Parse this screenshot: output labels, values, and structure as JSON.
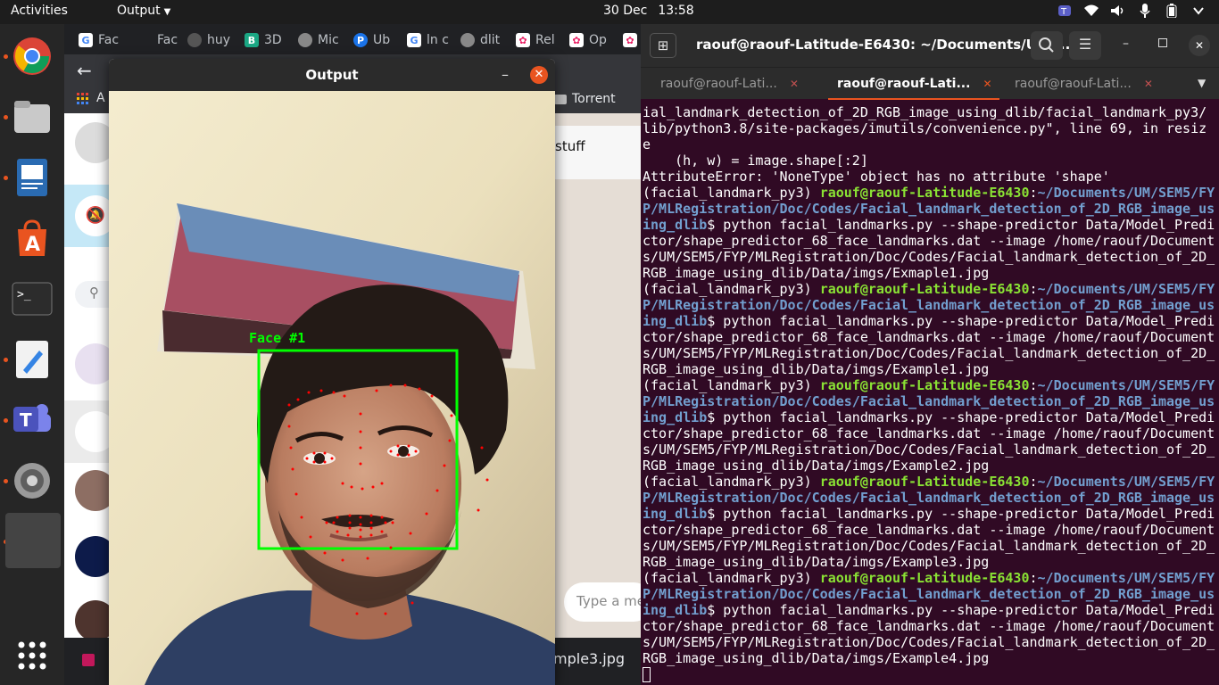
{
  "topbar": {
    "activities": "Activities",
    "app_menu": "Output",
    "date": "30 Dec",
    "time": "13:58"
  },
  "browser": {
    "tabs": [
      "Fac",
      "Fac",
      "huy",
      "3D",
      "Mic",
      "Ub",
      "ln c",
      "dlit",
      "Rel",
      "Op"
    ],
    "bookmarks": {
      "first": "A",
      "folder": "Torrent"
    },
    "chat_header": "stuff",
    "message_placeholder": "Type a message",
    "download_item": "mple3.jpg"
  },
  "output": {
    "title": "Output",
    "face_label": "Face #1",
    "colors": {
      "box": "#00ff00",
      "landmark": "#ff0000"
    }
  },
  "terminal": {
    "window_title": "raouf@raouf-Latitude-E6430: ~/Documents/UM/...",
    "tabs": [
      "raouf@raouf-Lati...",
      "raouf@raouf-Lati...",
      "raouf@raouf-Lati..."
    ],
    "prompt_env": "(facial_landmark_py3) ",
    "prompt_user": "raouf@raouf-Latitude-E6430",
    "prompt_sep": ":",
    "cwd": "~/Documents/UM/SEM5/FYP/MLRegistration/Doc/Codes/Facial_landmark_detection_of_2D_RGB_image_using_dlib",
    "cmd_prefix": "$ python facial_landmarks.py --shape-predictor Data/Model_Predictor/shape_predictor_68_face_landmarks.dat --image /home/raouf/Documents/UM/SEM5/FYP/MLRegistration/Doc/Codes/Facial_landmark_detection_of_2D_RGB_image_using_dlib/Data/imgs/",
    "pre_lines": [
      "ial_landmark_detection_of_2D_RGB_image_using_dlib/facial_landmark_py3/",
      "lib/python3.8/site-packages/imutils/convenience.py\", line 69, in resiz",
      "e",
      "    (h, w) = image.shape[:2]",
      "AttributeError: 'NoneType' object has no attribute 'shape'"
    ],
    "images": [
      "Exmaple1.jpg",
      "Example1.jpg",
      "Example2.jpg",
      "Example3.jpg",
      "Example4.jpg"
    ]
  }
}
